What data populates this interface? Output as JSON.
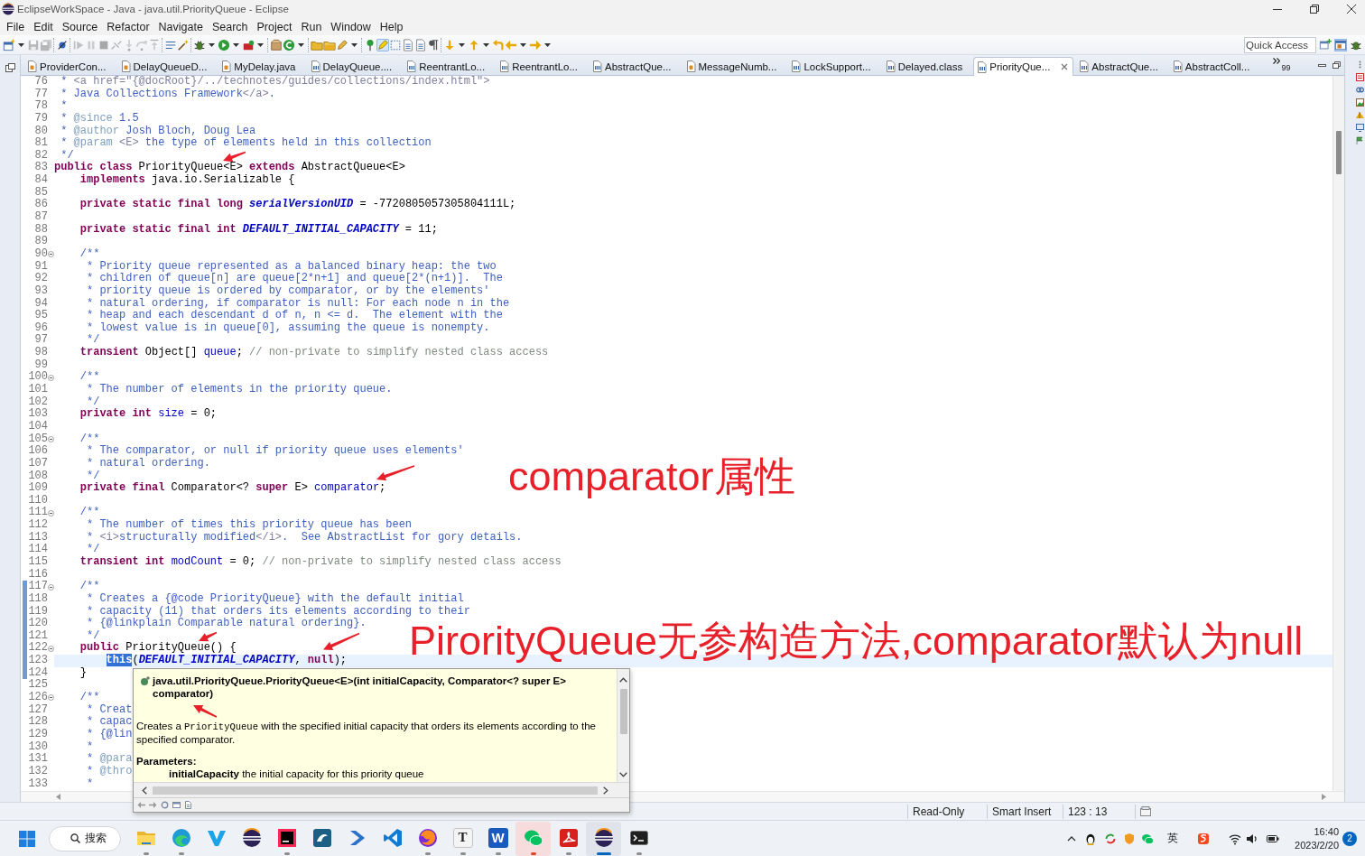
{
  "window": {
    "title": "EclipseWorkSpace - Java - java.util.PriorityQueue - Eclipse"
  },
  "menu": [
    "File",
    "Edit",
    "Source",
    "Refactor",
    "Navigate",
    "Search",
    "Project",
    "Run",
    "Window",
    "Help"
  ],
  "toolbar": {
    "groups": [
      [
        {
          "kind": "new",
          "dropdown": true,
          "disabled": false,
          "pressed": false
        },
        {
          "kind": "save",
          "dropdown": false,
          "disabled": true,
          "pressed": false
        },
        {
          "kind": "saveall",
          "dropdown": false,
          "disabled": true,
          "pressed": false
        }
      ],
      [
        {
          "kind": "skip",
          "dropdown": false,
          "disabled": false,
          "pressed": false
        }
      ],
      [
        {
          "kind": "resume",
          "dropdown": false,
          "disabled": true,
          "pressed": false
        },
        {
          "kind": "suspend",
          "dropdown": false,
          "disabled": true,
          "pressed": false
        },
        {
          "kind": "terminate",
          "dropdown": false,
          "disabled": true,
          "pressed": false
        },
        {
          "kind": "disconnect",
          "dropdown": false,
          "disabled": true,
          "pressed": false
        },
        {
          "kind": "stepinto",
          "dropdown": false,
          "disabled": true,
          "pressed": false
        },
        {
          "kind": "stepover",
          "dropdown": false,
          "disabled": true,
          "pressed": false
        },
        {
          "kind": "stepreturn",
          "dropdown": false,
          "disabled": true,
          "pressed": false
        }
      ],
      [
        {
          "kind": "dropframe",
          "dropdown": false,
          "disabled": false,
          "pressed": false
        },
        {
          "kind": "wand",
          "dropdown": false,
          "disabled": false,
          "pressed": false
        }
      ],
      [
        {
          "kind": "debug",
          "dropdown": true,
          "disabled": false,
          "pressed": false
        },
        {
          "kind": "run",
          "dropdown": true,
          "disabled": false,
          "pressed": false
        },
        {
          "kind": "tools",
          "dropdown": true,
          "disabled": false,
          "pressed": false
        }
      ],
      [
        {
          "kind": "project",
          "dropdown": false,
          "disabled": false,
          "pressed": false
        },
        {
          "kind": "class",
          "dropdown": true,
          "disabled": false,
          "pressed": false
        }
      ],
      [
        {
          "kind": "opentype",
          "dropdown": false,
          "disabled": false,
          "pressed": false
        },
        {
          "kind": "opentask",
          "dropdown": false,
          "disabled": false,
          "pressed": false
        },
        {
          "kind": "search",
          "dropdown": true,
          "disabled": false,
          "pressed": false
        }
      ],
      [
        {
          "kind": "breadcrumb",
          "dropdown": false,
          "disabled": false,
          "pressed": false
        },
        {
          "kind": "occurrences",
          "dropdown": false,
          "disabled": false,
          "pressed": true
        },
        {
          "kind": "block",
          "dropdown": false,
          "disabled": false,
          "pressed": false
        },
        {
          "kind": "doc",
          "dropdown": false,
          "disabled": false,
          "pressed": false
        },
        {
          "kind": "doc",
          "dropdown": false,
          "disabled": false,
          "pressed": false
        },
        {
          "kind": "whitespace",
          "dropdown": false,
          "disabled": false,
          "pressed": false
        }
      ],
      [
        {
          "kind": "nextann",
          "dropdown": true,
          "disabled": false,
          "pressed": false
        },
        {
          "kind": "prevann",
          "dropdown": true,
          "disabled": false,
          "pressed": false
        },
        {
          "kind": "lastedit",
          "dropdown": false,
          "disabled": false,
          "pressed": false
        },
        {
          "kind": "back",
          "dropdown": true,
          "disabled": false,
          "pressed": false
        },
        {
          "kind": "forward",
          "dropdown": true,
          "disabled": false,
          "pressed": false
        }
      ]
    ],
    "quick_access": {
      "placeholder": "Quick Access"
    },
    "perspectives": [
      {
        "kind": "open",
        "selected": false
      },
      {
        "kind": "java",
        "selected": true
      },
      {
        "kind": "debug",
        "selected": false
      }
    ]
  },
  "tabs": [
    {
      "label": "ProviderCon...",
      "kind": "java",
      "selected": false
    },
    {
      "label": "DelayQueueD...",
      "kind": "java",
      "selected": false
    },
    {
      "label": "MyDelay.java",
      "kind": "java",
      "selected": false
    },
    {
      "label": "DelayQueue....",
      "kind": "class",
      "selected": false
    },
    {
      "label": "ReentrantLo...",
      "kind": "class",
      "selected": false
    },
    {
      "label": "ReentrantLo...",
      "kind": "class",
      "selected": false
    },
    {
      "label": "AbstractQue...",
      "kind": "class",
      "selected": false
    },
    {
      "label": "MessageNumb...",
      "kind": "java",
      "selected": false
    },
    {
      "label": "LockSupport...",
      "kind": "class",
      "selected": false
    },
    {
      "label": "Delayed.class",
      "kind": "class",
      "selected": false
    },
    {
      "label": "PriorityQue...",
      "kind": "class",
      "selected": true
    },
    {
      "label": "AbstractQue...",
      "kind": "class",
      "selected": false
    },
    {
      "label": "AbstractColl...",
      "kind": "class",
      "selected": false
    }
  ],
  "tab_overflow": {
    "count": "99"
  },
  "editor": {
    "lines": [
      {
        "number": "76",
        "fold": false,
        "changed": false,
        "current": false,
        "tokens": [
          {
            "kind": "doc",
            "text": " * "
          },
          {
            "kind": "html",
            "text": "<a href=\"{@docRoot}/../technotes/guides/collections/index.html\">"
          }
        ]
      },
      {
        "number": "77",
        "fold": false,
        "changed": false,
        "current": false,
        "tokens": [
          {
            "kind": "doc",
            "text": " * Java Collections Framework"
          },
          {
            "kind": "html",
            "text": "</a>"
          },
          {
            "kind": "doc",
            "text": "."
          }
        ]
      },
      {
        "number": "78",
        "fold": false,
        "changed": false,
        "current": false,
        "tokens": [
          {
            "kind": "doc",
            "text": " *"
          }
        ]
      },
      {
        "number": "79",
        "fold": false,
        "changed": false,
        "current": false,
        "tokens": [
          {
            "kind": "doc",
            "text": " * "
          },
          {
            "kind": "tag",
            "text": "@since"
          },
          {
            "kind": "doc",
            "text": " 1.5"
          }
        ]
      },
      {
        "number": "80",
        "fold": false,
        "changed": false,
        "current": false,
        "tokens": [
          {
            "kind": "doc",
            "text": " * "
          },
          {
            "kind": "tag",
            "text": "@author"
          },
          {
            "kind": "doc",
            "text": " Josh Bloch, Doug Lea"
          }
        ]
      },
      {
        "number": "81",
        "fold": false,
        "changed": false,
        "current": false,
        "tokens": [
          {
            "kind": "doc",
            "text": " * "
          },
          {
            "kind": "tag",
            "text": "@param"
          },
          {
            "kind": "html",
            "text": " <E>"
          },
          {
            "kind": "doc",
            "text": " the type of elements held in this collection"
          }
        ]
      },
      {
        "number": "82",
        "fold": false,
        "changed": false,
        "current": false,
        "tokens": [
          {
            "kind": "doc",
            "text": " */"
          }
        ]
      },
      {
        "number": "83",
        "fold": false,
        "changed": false,
        "current": false,
        "tokens": [
          {
            "kind": "kw",
            "text": "public class"
          },
          {
            "kind": "plain",
            "text": " PriorityQueue<E> "
          },
          {
            "kind": "kw",
            "text": "extends"
          },
          {
            "kind": "plain",
            "text": " AbstractQueue<E>"
          }
        ]
      },
      {
        "number": "84",
        "fold": false,
        "changed": false,
        "current": false,
        "tokens": [
          {
            "kind": "kw",
            "text": "    implements"
          },
          {
            "kind": "plain",
            "text": " java.io.Serializable {"
          }
        ]
      },
      {
        "number": "85",
        "fold": false,
        "changed": false,
        "current": false
      },
      {
        "number": "86",
        "fold": false,
        "changed": false,
        "current": false,
        "tokens": [
          {
            "kind": "kw",
            "text": "    private static final long "
          },
          {
            "kind": "const",
            "text": "serialVersionUID"
          },
          {
            "kind": "plain",
            "text": " = -7720805057305804111L;"
          }
        ]
      },
      {
        "number": "87",
        "fold": false,
        "changed": false,
        "current": false
      },
      {
        "number": "88",
        "fold": false,
        "changed": false,
        "current": false,
        "tokens": [
          {
            "kind": "kw",
            "text": "    private static final int "
          },
          {
            "kind": "const",
            "text": "DEFAULT_INITIAL_CAPACITY"
          },
          {
            "kind": "plain",
            "text": " = 11;"
          }
        ]
      },
      {
        "number": "89",
        "fold": false,
        "changed": false,
        "current": false
      },
      {
        "number": "90",
        "fold": true,
        "changed": false,
        "current": false,
        "tokens": [
          {
            "kind": "doc",
            "text": "    /**"
          }
        ]
      },
      {
        "number": "91",
        "fold": false,
        "changed": false,
        "current": false,
        "tokens": [
          {
            "kind": "doc",
            "text": "     * Priority queue represented as a balanced binary heap: the two"
          }
        ]
      },
      {
        "number": "92",
        "fold": false,
        "changed": false,
        "current": false,
        "tokens": [
          {
            "kind": "doc",
            "text": "     * children of queue[n] are queue[2*n+1] and queue[2*(n+1)].  The"
          }
        ]
      },
      {
        "number": "93",
        "fold": false,
        "changed": false,
        "current": false,
        "tokens": [
          {
            "kind": "doc",
            "text": "     * priority queue is ordered by comparator, or by the elements'"
          }
        ]
      },
      {
        "number": "94",
        "fold": false,
        "changed": false,
        "current": false,
        "tokens": [
          {
            "kind": "doc",
            "text": "     * natural ordering, if comparator is null: For each node n in the"
          }
        ]
      },
      {
        "number": "95",
        "fold": false,
        "changed": false,
        "current": false,
        "tokens": [
          {
            "kind": "doc",
            "text": "     * heap and each descendant d of n, n <= d.  The element with the"
          }
        ]
      },
      {
        "number": "96",
        "fold": false,
        "changed": false,
        "current": false,
        "tokens": [
          {
            "kind": "doc",
            "text": "     * lowest value is in queue[0], assuming the queue is nonempty."
          }
        ]
      },
      {
        "number": "97",
        "fold": false,
        "changed": false,
        "current": false,
        "tokens": [
          {
            "kind": "doc",
            "text": "     */"
          }
        ]
      },
      {
        "number": "98",
        "fold": false,
        "changed": false,
        "current": false,
        "tokens": [
          {
            "kind": "kw",
            "text": "    transient"
          },
          {
            "kind": "plain",
            "text": " Object[] "
          },
          {
            "kind": "field",
            "text": "queue"
          },
          {
            "kind": "plain",
            "text": "; "
          },
          {
            "kind": "comment",
            "text": "// non-private to simplify nested class access"
          }
        ]
      },
      {
        "number": "99",
        "fold": false,
        "changed": false,
        "current": false
      },
      {
        "number": "100",
        "fold": true,
        "changed": false,
        "current": false,
        "tokens": [
          {
            "kind": "doc",
            "text": "    /**"
          }
        ]
      },
      {
        "number": "101",
        "fold": false,
        "changed": false,
        "current": false,
        "tokens": [
          {
            "kind": "doc",
            "text": "     * The number of elements in the priority queue."
          }
        ]
      },
      {
        "number": "102",
        "fold": false,
        "changed": false,
        "current": false,
        "tokens": [
          {
            "kind": "doc",
            "text": "     */"
          }
        ]
      },
      {
        "number": "103",
        "fold": false,
        "changed": false,
        "current": false,
        "tokens": [
          {
            "kind": "kw",
            "text": "    private int "
          },
          {
            "kind": "field",
            "text": "size"
          },
          {
            "kind": "plain",
            "text": " = 0;"
          }
        ]
      },
      {
        "number": "104",
        "fold": false,
        "changed": false,
        "current": false
      },
      {
        "number": "105",
        "fold": true,
        "changed": false,
        "current": false,
        "tokens": [
          {
            "kind": "doc",
            "text": "    /**"
          }
        ]
      },
      {
        "number": "106",
        "fold": false,
        "changed": false,
        "current": false,
        "tokens": [
          {
            "kind": "doc",
            "text": "     * The comparator, or null if priority queue uses elements'"
          }
        ]
      },
      {
        "number": "107",
        "fold": false,
        "changed": false,
        "current": false,
        "tokens": [
          {
            "kind": "doc",
            "text": "     * natural ordering."
          }
        ]
      },
      {
        "number": "108",
        "fold": false,
        "changed": false,
        "current": false,
        "tokens": [
          {
            "kind": "doc",
            "text": "     */"
          }
        ]
      },
      {
        "number": "109",
        "fold": false,
        "changed": false,
        "current": false,
        "tokens": [
          {
            "kind": "kw",
            "text": "    private final"
          },
          {
            "kind": "plain",
            "text": " Comparator<? "
          },
          {
            "kind": "kw",
            "text": "super"
          },
          {
            "kind": "plain",
            "text": " E> "
          },
          {
            "kind": "field",
            "text": "comparator"
          },
          {
            "kind": "plain",
            "text": ";"
          }
        ]
      },
      {
        "number": "110",
        "fold": false,
        "changed": false,
        "current": false
      },
      {
        "number": "111",
        "fold": true,
        "changed": false,
        "current": false,
        "tokens": [
          {
            "kind": "doc",
            "text": "    /**"
          }
        ]
      },
      {
        "number": "112",
        "fold": false,
        "changed": false,
        "current": false,
        "tokens": [
          {
            "kind": "doc",
            "text": "     * The number of times this priority queue has been"
          }
        ]
      },
      {
        "number": "113",
        "fold": false,
        "changed": false,
        "current": false,
        "tokens": [
          {
            "kind": "doc",
            "text": "     * "
          },
          {
            "kind": "html",
            "text": "<i>"
          },
          {
            "kind": "doc",
            "text": "structurally modified"
          },
          {
            "kind": "html",
            "text": "</i>"
          },
          {
            "kind": "doc",
            "text": ".  See AbstractList for gory details."
          }
        ]
      },
      {
        "number": "114",
        "fold": false,
        "changed": false,
        "current": false,
        "tokens": [
          {
            "kind": "doc",
            "text": "     */"
          }
        ]
      },
      {
        "number": "115",
        "fold": false,
        "changed": false,
        "current": false,
        "tokens": [
          {
            "kind": "kw",
            "text": "    transient int "
          },
          {
            "kind": "field",
            "text": "modCount"
          },
          {
            "kind": "plain",
            "text": " = 0; "
          },
          {
            "kind": "comment",
            "text": "// non-private to simplify nested class access"
          }
        ]
      },
      {
        "number": "116",
        "fold": false,
        "changed": false,
        "current": false
      },
      {
        "number": "117",
        "fold": true,
        "changed": true,
        "current": false,
        "tokens": [
          {
            "kind": "doc",
            "text": "    /**"
          }
        ]
      },
      {
        "number": "118",
        "fold": false,
        "changed": true,
        "current": false,
        "tokens": [
          {
            "kind": "doc",
            "text": "     * Creates a {@code PriorityQueue} with the default initial"
          }
        ]
      },
      {
        "number": "119",
        "fold": false,
        "changed": true,
        "current": false,
        "tokens": [
          {
            "kind": "doc",
            "text": "     * capacity (11) that orders its elements according to their"
          }
        ]
      },
      {
        "number": "120",
        "fold": false,
        "changed": true,
        "current": false,
        "tokens": [
          {
            "kind": "doc",
            "text": "     * {@linkplain Comparable natural ordering}."
          }
        ]
      },
      {
        "number": "121",
        "fold": false,
        "changed": true,
        "current": false,
        "tokens": [
          {
            "kind": "doc",
            "text": "     */"
          }
        ]
      },
      {
        "number": "122",
        "fold": true,
        "changed": true,
        "current": false,
        "tokens": [
          {
            "kind": "kw",
            "text": "    public"
          },
          {
            "kind": "plain",
            "text": " PriorityQueue() {"
          }
        ]
      },
      {
        "number": "123",
        "fold": false,
        "changed": true,
        "current": true,
        "tokens": [
          {
            "kind": "sel",
            "text": "        this"
          },
          {
            "kind": "plain",
            "text": "("
          },
          {
            "kind": "const",
            "text": "DEFAULT_INITIAL_CAPACITY"
          },
          {
            "kind": "plain",
            "text": ", "
          },
          {
            "kind": "kw",
            "text": "null"
          },
          {
            "kind": "plain",
            "text": ");"
          }
        ]
      },
      {
        "number": "124",
        "fold": false,
        "changed": true,
        "current": false,
        "tokens": [
          {
            "kind": "plain",
            "text": "    }"
          }
        ]
      },
      {
        "number": "125",
        "fold": false,
        "changed": false,
        "current": false
      },
      {
        "number": "126",
        "fold": true,
        "changed": false,
        "current": false,
        "tokens": [
          {
            "kind": "doc",
            "text": "    /**"
          }
        ]
      },
      {
        "number": "127",
        "fold": false,
        "changed": false,
        "current": false,
        "tokens": [
          {
            "kind": "doc",
            "text": "     * Creat"
          }
        ]
      },
      {
        "number": "128",
        "fold": false,
        "changed": false,
        "current": false,
        "tokens": [
          {
            "kind": "doc",
            "text": "     * capac"
          }
        ]
      },
      {
        "number": "129",
        "fold": false,
        "changed": false,
        "current": false,
        "tokens": [
          {
            "kind": "doc",
            "text": "     * {@lin"
          }
        ]
      },
      {
        "number": "130",
        "fold": false,
        "changed": false,
        "current": false,
        "tokens": [
          {
            "kind": "doc",
            "text": "     *"
          }
        ]
      },
      {
        "number": "131",
        "fold": false,
        "changed": false,
        "current": false,
        "tokens": [
          {
            "kind": "doc",
            "text": "     * "
          },
          {
            "kind": "tag",
            "text": "@para"
          }
        ]
      },
      {
        "number": "132",
        "fold": false,
        "changed": false,
        "current": false,
        "tokens": [
          {
            "kind": "doc",
            "text": "     * "
          },
          {
            "kind": "tag",
            "text": "@thro"
          }
        ]
      },
      {
        "number": "133",
        "fold": false,
        "changed": false,
        "current": false,
        "tokens": [
          {
            "kind": "doc",
            "text": "     *"
          }
        ]
      }
    ]
  },
  "javadoc_hover": {
    "signature": "java.util.PriorityQueue.PriorityQueue<E>(int initialCapacity, Comparator<? super E> comparator)",
    "description": [
      {
        "kind": "text",
        "text": "Creates a "
      },
      {
        "kind": "code",
        "text": "PriorityQueue"
      },
      {
        "kind": "text",
        "text": " with the specified initial capacity that orders its elements according to the specified comparator."
      }
    ],
    "parameters_heading": "Parameters:",
    "parameters": [
      "**initialCapacity** the initial capacity for this priority queue"
    ]
  },
  "status_bar": {
    "fields": [
      "Read-Only",
      "Smart Insert",
      "123 : 13"
    ]
  },
  "taskbar": {
    "search": {
      "label": "搜索"
    },
    "apps": [
      {
        "kind": "folder",
        "running": true,
        "selected": false,
        "attention": false
      },
      {
        "kind": "wave",
        "running": true,
        "selected": false,
        "attention": false
      },
      {
        "kind": "vee",
        "running": false,
        "selected": false,
        "attention": false
      },
      {
        "kind": "ball",
        "running": false,
        "selected": false,
        "attention": false
      },
      {
        "kind": "square",
        "running": true,
        "selected": false,
        "attention": false
      },
      {
        "kind": "dolphin",
        "running": false,
        "selected": false,
        "attention": false
      },
      {
        "kind": "prompt",
        "running": false,
        "selected": false,
        "attention": false
      },
      {
        "kind": "ribbon",
        "running": false,
        "selected": false,
        "attention": false
      },
      {
        "kind": "fox",
        "running": true,
        "selected": false,
        "attention": false
      },
      {
        "kind": "lightletter",
        "glyph": "T",
        "running": true,
        "selected": false,
        "attention": false
      },
      {
        "kind": "darkletter",
        "glyph": "W",
        "running": true,
        "selected": false,
        "attention": false
      },
      {
        "kind": "chat",
        "running": true,
        "selected": false,
        "attention": true
      },
      {
        "kind": "pdf",
        "running": true,
        "selected": false,
        "attention": false
      },
      {
        "kind": "ball",
        "running": true,
        "selected": true,
        "attention": false
      },
      {
        "kind": "console",
        "running": true,
        "selected": false,
        "attention": false
      }
    ],
    "tray": {
      "input_method": "英",
      "time": "16:40",
      "date": "2023/2/20",
      "notifications": "2"
    }
  },
  "annotations": {
    "labels": [
      "comparator属性",
      "PirorityQueue无参构造方法,comparator默认为null"
    ]
  }
}
